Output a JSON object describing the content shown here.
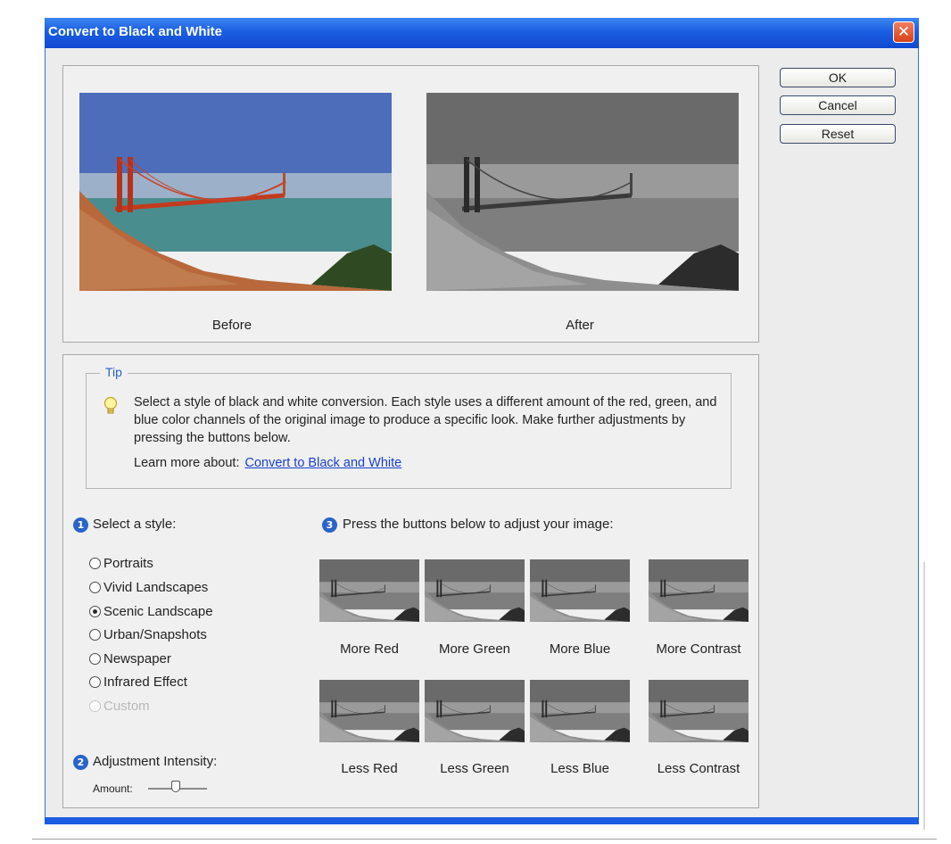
{
  "window": {
    "title": "Convert to Black and White",
    "close_glyph": "✕"
  },
  "buttons": {
    "ok": "OK",
    "cancel": "Cancel",
    "reset": "Reset"
  },
  "preview": {
    "before_label": "Before",
    "after_label": "After"
  },
  "tip": {
    "label": "Tip",
    "icon": "lightbulb-icon",
    "text": "Select a style of black and white conversion. Each style uses a different amount of the red, green, and blue color channels of the original image to produce a specific look. Make further adjustments by pressing the buttons below.",
    "learn_more_prefix": "Learn more about:",
    "learn_more_link": "Convert to Black and White"
  },
  "step1": {
    "number": "1",
    "label": "Select a style:"
  },
  "styles": [
    {
      "label": "Portraits",
      "checked": false,
      "disabled": false
    },
    {
      "label": "Vivid Landscapes",
      "checked": false,
      "disabled": false
    },
    {
      "label": "Scenic Landscape",
      "checked": true,
      "disabled": false
    },
    {
      "label": "Urban/Snapshots",
      "checked": false,
      "disabled": false
    },
    {
      "label": "Newspaper",
      "checked": false,
      "disabled": false
    },
    {
      "label": "Infrared Effect",
      "checked": false,
      "disabled": false
    },
    {
      "label": "Custom",
      "checked": false,
      "disabled": true
    }
  ],
  "step2": {
    "number": "2",
    "label": "Adjustment Intensity:",
    "amount_label": "Amount:"
  },
  "step3": {
    "number": "3",
    "label": "Press the buttons below to adjust your image:"
  },
  "adjust_top": [
    "More Red",
    "More Green",
    "More Blue",
    "More Contrast"
  ],
  "adjust_bottom": [
    "Less Red",
    "Less Green",
    "Less Blue",
    "Less Contrast"
  ],
  "colors": {
    "titlebar": "#1c5ee2",
    "accent": "#2a64c8",
    "link": "#1a3fd0"
  }
}
